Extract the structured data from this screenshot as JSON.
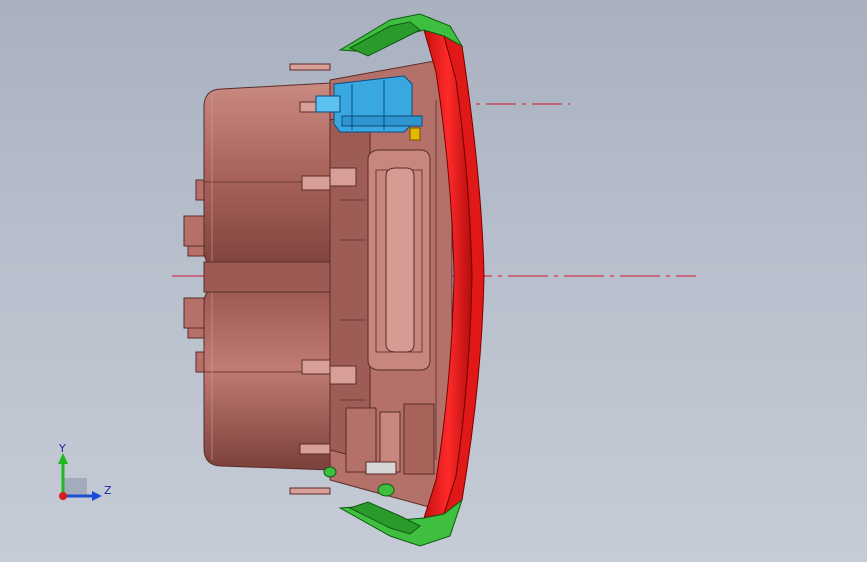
{
  "viewport": {
    "background_top": "#a9b1c0",
    "background_bottom": "#c6ccd6"
  },
  "model": {
    "body_color": "#b06a62",
    "body_shade": "#8a4a44",
    "bezel_color": "#ee1c1c",
    "cap_color": "#3fbf3f",
    "connector_color": "#3aa8e0",
    "accent_color": "#e6b800",
    "centerline_color": "#d0142c"
  },
  "triad": {
    "y_label": "Y",
    "z_label": "Z",
    "y_color": "#1fb81f",
    "z_color": "#1a4fd6",
    "origin_color": "#d81b1b"
  }
}
